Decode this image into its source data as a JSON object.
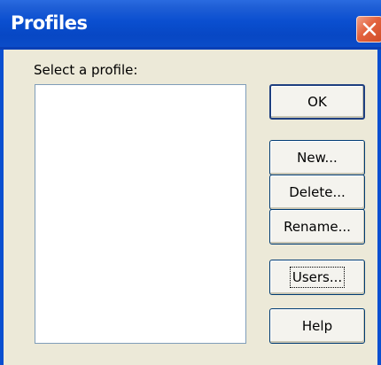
{
  "window": {
    "title": "Profiles",
    "close_icon": "close-icon"
  },
  "content": {
    "select_label": "Select a profile:",
    "profiles": []
  },
  "buttons": {
    "ok": "OK",
    "new": "New...",
    "delete": "Delete...",
    "rename": "Rename...",
    "users": "Users...",
    "help": "Help"
  },
  "colors": {
    "titlebar": "#0a4fd0",
    "close_button": "#e3623d",
    "dialog_background": "#ece9d8"
  }
}
